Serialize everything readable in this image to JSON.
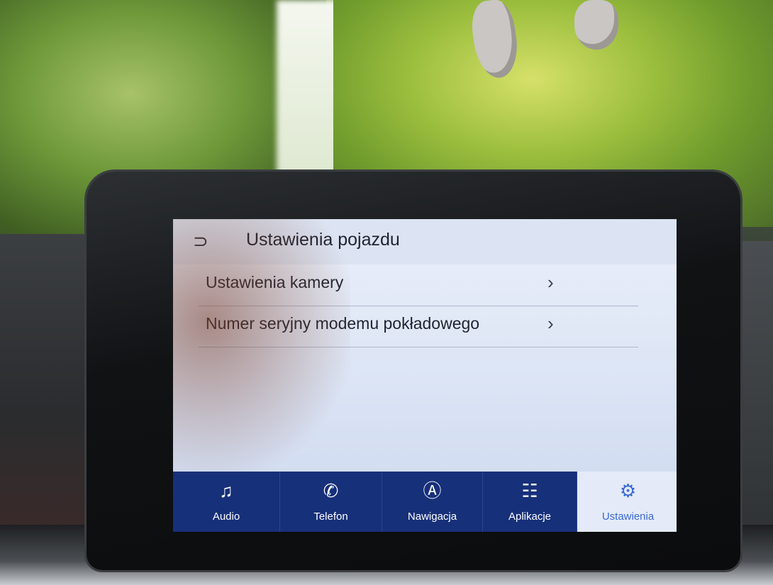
{
  "header": {
    "back_icon": "back-arrow-icon",
    "title": "Ustawienia pojazdu"
  },
  "list": {
    "items": [
      {
        "label": "Ustawienia kamery",
        "icon": "chevron-right-icon"
      },
      {
        "label": "Numer seryjny modemu pokładowego",
        "icon": "chevron-right-icon"
      }
    ]
  },
  "navbar": {
    "items": [
      {
        "label": "Audio",
        "icon": "music-note-icon"
      },
      {
        "label": "Telefon",
        "icon": "phone-icon"
      },
      {
        "label": "Nawigacja",
        "icon": "navigation-icon"
      },
      {
        "label": "Aplikacje",
        "icon": "apps-grid-icon"
      },
      {
        "label": "Ustawienia",
        "icon": "settings-gear-icon",
        "active": true
      }
    ]
  },
  "colors": {
    "navbar_bg": "#17307a",
    "active_tab_bg": "#e4eaf7",
    "active_tab_text": "#3a6ad3",
    "screen_bg": "#d7e1f3"
  }
}
